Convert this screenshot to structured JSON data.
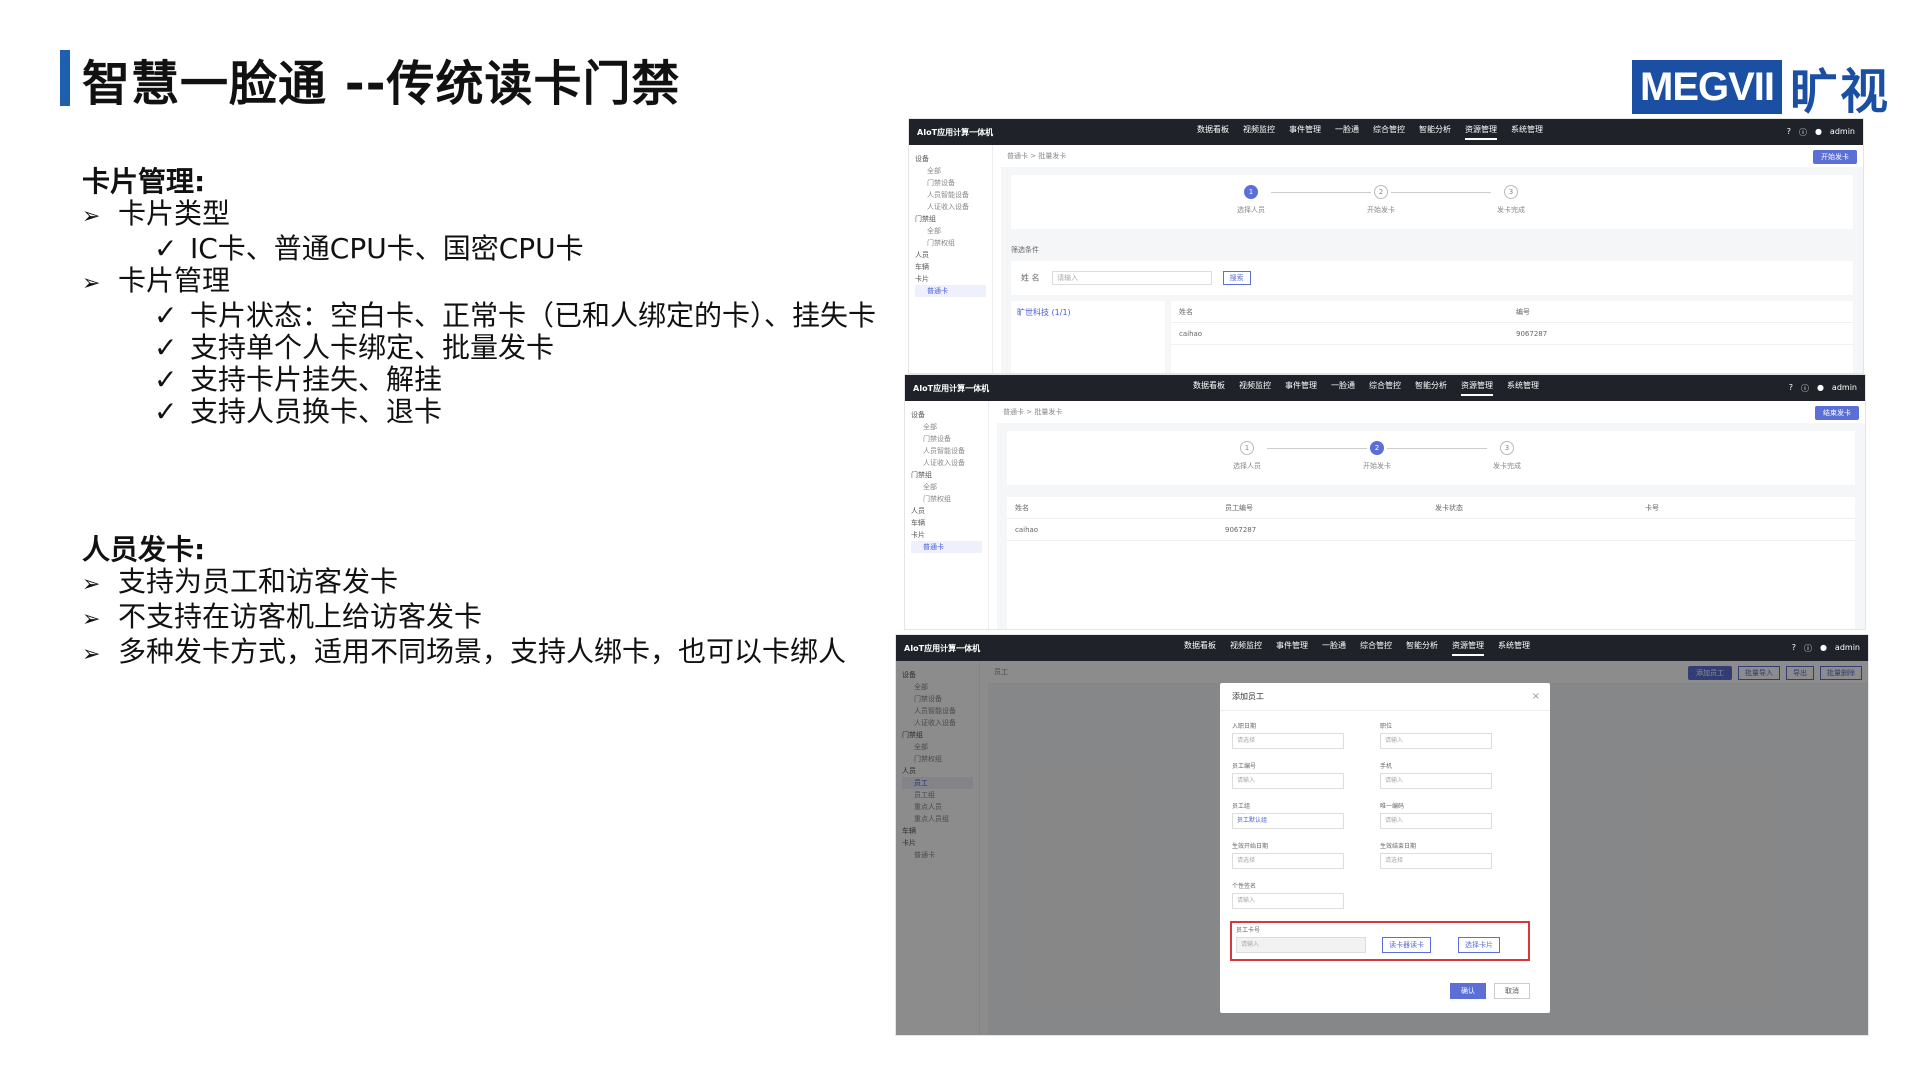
{
  "slide": {
    "title": "智慧一脸通 --传统读卡门禁",
    "logo_text": "MEGVII",
    "logo_cn": "旷视",
    "card_section": {
      "heading": "卡片管理:",
      "items": [
        {
          "bullet": "➢",
          "label": "卡片类型",
          "subs": [
            "IC卡、普通CPU卡、国密CPU卡"
          ]
        },
        {
          "bullet": "➢",
          "label": "卡片管理",
          "subs": [
            "卡片状态：空白卡、正常卡（已和人绑定的卡）、挂失卡",
            "支持单个人卡绑定、批量发卡",
            "支持卡片挂失、解挂",
            "支持人员换卡、退卡"
          ]
        }
      ],
      "check": "✓"
    },
    "issue_section": {
      "heading": "人员发卡:",
      "items": [
        "支持为员工和访客发卡",
        "不支持在访客机上给访客发卡",
        "多种发卡方式，适用不同场景，支持人绑卡，也可以卡绑人"
      ],
      "bullet": "➢"
    }
  },
  "shot1": {
    "app": "AIoT应用计算一体机",
    "menu": [
      "数据看板",
      "视频监控",
      "事件管理",
      "一脸通",
      "综合管控",
      "智能分析",
      "资源管理",
      "系统管理"
    ],
    "active_menu": "资源管理",
    "user": "admin",
    "crumb": "普通卡  >  批量发卡",
    "primary_btn": "开始发卡",
    "steps": [
      "选择人员",
      "开始发卡",
      "发卡完成"
    ],
    "filter_label": "筛选条件",
    "name_label": "姓 名",
    "name_placeholder": "请输入",
    "search_btn": "搜索",
    "tree_item": "旷世科技 (1/1)",
    "cols": [
      "姓名",
      "编号"
    ],
    "row": [
      "caihao",
      "9067287"
    ],
    "side": [
      "设备",
      "全部",
      "门禁设备",
      "人员智能设备",
      "人证收入设备",
      "门禁组",
      "全部",
      "门禁权组",
      "人员",
      "车辆",
      "卡片",
      "普通卡"
    ]
  },
  "shot2": {
    "app": "AIoT应用计算一体机",
    "menu": [
      "数据看板",
      "视频监控",
      "事件管理",
      "一脸通",
      "综合管控",
      "智能分析",
      "资源管理",
      "系统管理"
    ],
    "user": "admin",
    "crumb": "普通卡  >  批量发卡",
    "primary_btn": "结束发卡",
    "steps": [
      "选择人员",
      "开始发卡",
      "发卡完成"
    ],
    "cols": [
      "姓名",
      "员工编号",
      "发卡状态",
      "卡号"
    ],
    "row": [
      "caihao",
      "9067287",
      "",
      ""
    ],
    "side": [
      "设备",
      "全部",
      "门禁设备",
      "人员智能设备",
      "人证收入设备",
      "门禁组",
      "全部",
      "门禁权组",
      "人员",
      "车辆",
      "卡片",
      "普通卡"
    ]
  },
  "shot3": {
    "app": "AIoT应用计算一体机",
    "menu": [
      "数据看板",
      "视频监控",
      "事件管理",
      "一脸通",
      "综合管控",
      "智能分析",
      "资源管理",
      "系统管理"
    ],
    "user": "admin",
    "crumb": "员工",
    "top_btns": [
      "添加员工",
      "批量导入",
      "导出",
      "批量删除"
    ],
    "side": [
      "设备",
      "全部",
      "门禁设备",
      "人员智能设备",
      "人证收入设备",
      "门禁组",
      "全部",
      "门禁权组",
      "人员",
      "员工",
      "员工组",
      "重点人员",
      "重点人员组",
      "车辆",
      "卡片",
      "普通卡"
    ],
    "modal": {
      "title": "添加员工",
      "close": "×",
      "fields_left": [
        {
          "label": "入职日期",
          "placeholder": "请选择"
        },
        {
          "label": "员工编号",
          "placeholder": "请输入"
        },
        {
          "label": "员工组",
          "placeholder": "员工默认组"
        },
        {
          "label": "生效开始日期",
          "placeholder": "请选择"
        },
        {
          "label": "个性签名",
          "placeholder": "请输入"
        }
      ],
      "fields_right": [
        {
          "label": "职位",
          "placeholder": "请输入"
        },
        {
          "label": "手机",
          "placeholder": "请输入"
        },
        {
          "label": "唯一编码",
          "placeholder": "请输入"
        },
        {
          "label": "生效结束日期",
          "placeholder": "请选择"
        }
      ],
      "card_label": "员工卡号",
      "card_placeholder": "请输入",
      "read_card_btn": "读卡器读卡",
      "choose_card_btn": "选择卡片",
      "confirm": "确认",
      "cancel": "取消"
    }
  }
}
